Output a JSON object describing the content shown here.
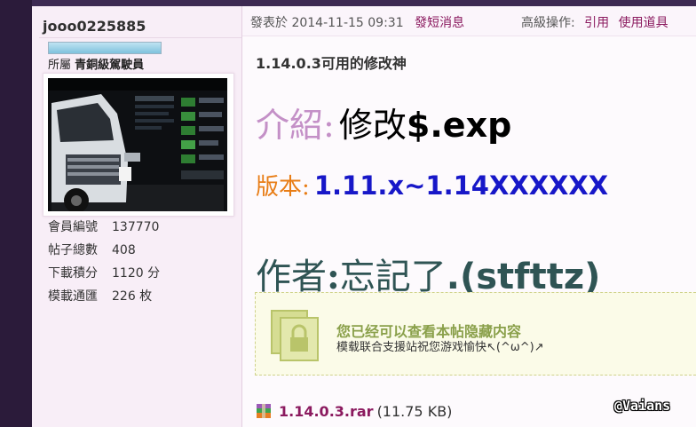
{
  "user": {
    "username": "jooo0225885",
    "rank_progress": 1.0,
    "group_label": "所屬",
    "group_name": "青銅級駕駛員",
    "stats": [
      {
        "label": "會員編號",
        "value": "137770"
      },
      {
        "label": "帖子總數",
        "value": "408"
      },
      {
        "label": "下載積分",
        "value": "1120 分"
      },
      {
        "label": "模載通匯",
        "value": "226 枚"
      }
    ]
  },
  "post": {
    "posted_label": "發表於",
    "posted_time": "2014-11-15 09:31",
    "message_link": "發短消息",
    "advanced_label": "高級操作:",
    "quote_link": "引用",
    "use_item_link": "使用道具"
  },
  "content": {
    "title": "1.14.0.3可用的修改神",
    "intro_label": "介紹:",
    "intro_value_cjk": "修改",
    "intro_value_latin": "$.exp",
    "version_label": "版本:",
    "version_value": "1.11.x~1.14XXXXXX",
    "author_label": "作者",
    "author_colon": ":",
    "author_value_cjk": "忘記了",
    "author_value_latin": ".(stfttz)"
  },
  "hidden_notice": {
    "title": "您已经可以查看本帖隐藏内容",
    "subtitle": "模载联合支援站祝您游戏愉快↖(^ω^)↗"
  },
  "attachment": {
    "filename": "1.14.0.3.rar",
    "size": "(11.75 KB)"
  },
  "watermark": "@Vaians",
  "colors": {
    "intro_label": "#c490c7",
    "version_label": "#e87d16",
    "version_value": "#1717c8",
    "author": "#2f5454",
    "link": "#8b1a5f"
  }
}
